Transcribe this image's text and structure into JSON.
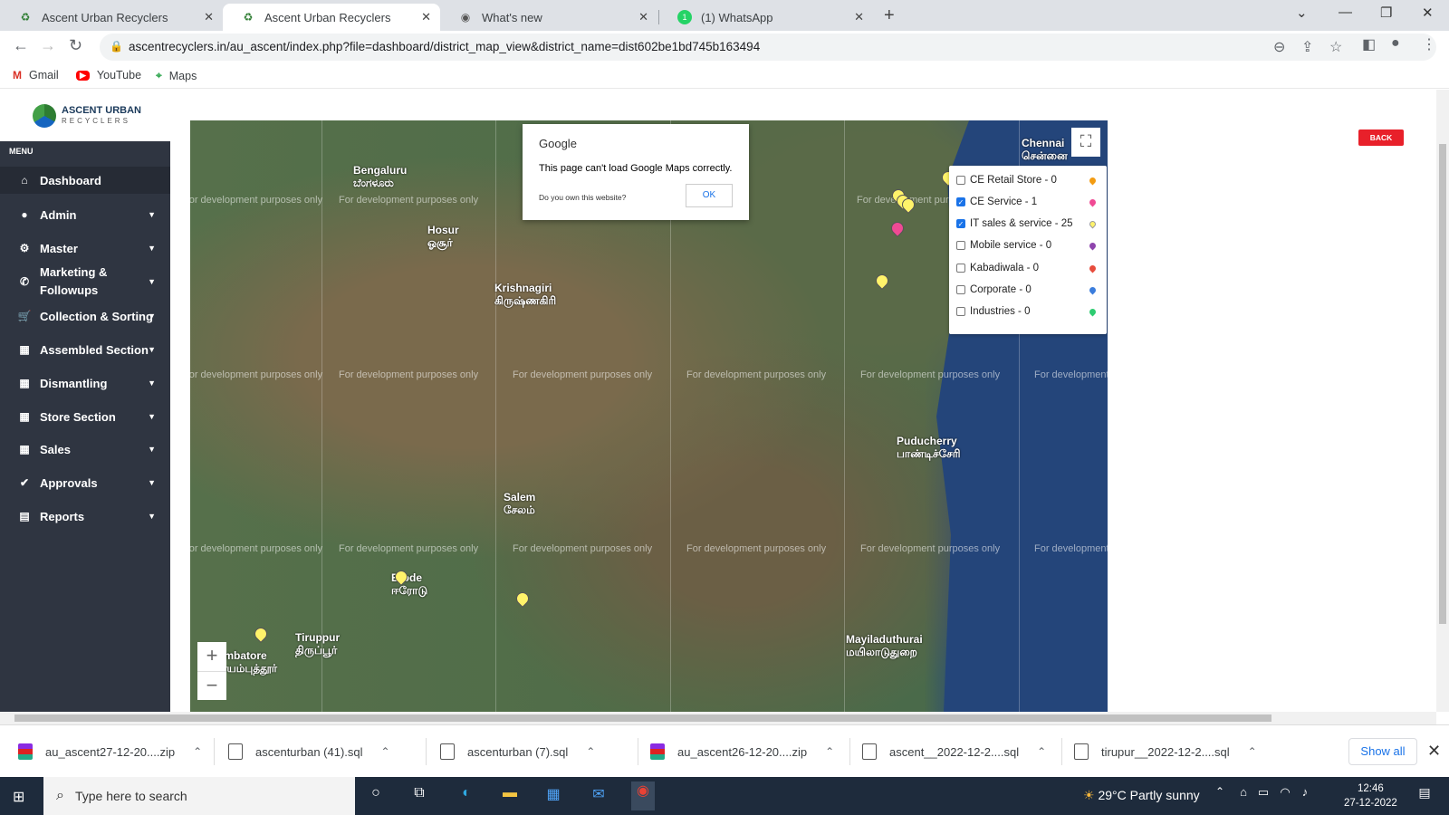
{
  "browser": {
    "tabs": [
      {
        "title": "Ascent Urban Recyclers",
        "active": false
      },
      {
        "title": "Ascent Urban Recyclers",
        "active": true
      },
      {
        "title": "What's new",
        "active": false
      },
      {
        "title": "(1) WhatsApp",
        "active": false
      }
    ],
    "url": "ascentrecyclers.in/au_ascent/index.php?file=dashboard/district_map_view&district_name=dist602be1bd745b163494",
    "bookmarks": [
      "Gmail",
      "YouTube",
      "Maps"
    ]
  },
  "app": {
    "logo_title": "ASCENT URBAN",
    "logo_subtitle": "RECYCLERS",
    "menu_label": "MENU",
    "sidebar": [
      {
        "label": "Dashboard",
        "icon": "home-icon",
        "caret": false
      },
      {
        "label": "Admin",
        "icon": "user-icon",
        "caret": true
      },
      {
        "label": "Master",
        "icon": "gear-icon",
        "caret": true
      },
      {
        "label": "Marketing &",
        "label2": "Followups",
        "icon": "phone-icon",
        "caret": true
      },
      {
        "label": "Collection & Sorting",
        "icon": "cart-icon",
        "caret": true
      },
      {
        "label": "Assembled Section",
        "icon": "table-icon",
        "caret": true
      },
      {
        "label": "Dismantling",
        "icon": "table-icon",
        "caret": true
      },
      {
        "label": "Store Section",
        "icon": "table-icon",
        "caret": true
      },
      {
        "label": "Sales",
        "icon": "table-icon",
        "caret": true
      },
      {
        "label": "Approvals",
        "icon": "check-circle-icon",
        "caret": true
      },
      {
        "label": "Reports",
        "icon": "file-icon",
        "caret": true
      }
    ],
    "back_label": "BACK"
  },
  "map": {
    "watermark": "For development purposes only",
    "dialog": {
      "title": "Google",
      "message": "This page can't load Google Maps correctly.",
      "question": "Do you own this website?",
      "ok_label": "OK"
    },
    "legend": [
      {
        "label": "CE Retail Store - 0",
        "checked": false,
        "color": "#f39c12"
      },
      {
        "label": "CE Service - 1",
        "checked": true,
        "color": "#f04a94"
      },
      {
        "label": "IT sales & service - 25",
        "checked": true,
        "color": "#fff36a"
      },
      {
        "label": "Mobile service - 0",
        "checked": false,
        "color": "#8e44ad"
      },
      {
        "label": "Kabadiwala - 0",
        "checked": false,
        "color": "#e74c3c"
      },
      {
        "label": "Corporate - 0",
        "checked": false,
        "color": "#3b7ddd"
      },
      {
        "label": "Industries - 0",
        "checked": false,
        "color": "#2ecc71"
      }
    ],
    "cities": [
      {
        "name": "Bengaluru",
        "ta": "ಬೆಂಗಳೂರು"
      },
      {
        "name": "Chennai",
        "ta": "சென்னை"
      },
      {
        "name": "Hosur",
        "ta": "ஓசூர்"
      },
      {
        "name": "Krishnagiri",
        "ta": "கிருஷ்ணகிரி"
      },
      {
        "name": "Salem",
        "ta": "சேலம்"
      },
      {
        "name": "Puducherry",
        "ta": "பாண்டிச்சேரி"
      },
      {
        "name": "Erode",
        "ta": "ஈரோடு"
      },
      {
        "name": "Tiruppur",
        "ta": "திருப்பூர்"
      },
      {
        "name": "Mayiladuthurai",
        "ta": "மயிலாடுதுறை"
      },
      {
        "name": "Coimbatore",
        "ta": "கோயம்புத்தூர்"
      }
    ],
    "zoom_in": "+",
    "zoom_out": "−"
  },
  "downloads": [
    {
      "name": "au_ascent27-12-20....zip",
      "zip": true
    },
    {
      "name": "ascenturban (41).sql",
      "zip": false
    },
    {
      "name": "ascenturban (7).sql",
      "zip": false
    },
    {
      "name": "au_ascent26-12-20....zip",
      "zip": true
    },
    {
      "name": "ascent__2022-12-2....sql",
      "zip": false
    },
    {
      "name": "tirupur__2022-12-2....sql",
      "zip": false
    }
  ],
  "show_all": "Show all",
  "taskbar": {
    "search_placeholder": "Type here to search",
    "weather": "29°C  Partly sunny",
    "time": "12:46",
    "date": "27-12-2022"
  }
}
